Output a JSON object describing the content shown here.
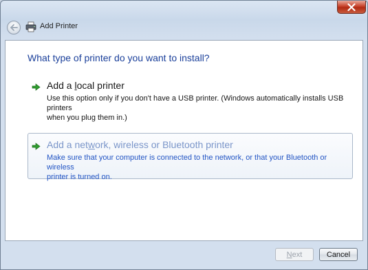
{
  "window": {
    "title": "Add Printer",
    "icons": [
      "back-arrow-icon",
      "printer-icon",
      "close-icon"
    ]
  },
  "content": {
    "question": "What type of printer do you want to install?",
    "options": [
      {
        "title_pre": "Add a ",
        "title_access": "l",
        "title_post": "ocal printer",
        "desc_line1": "Use this option only if you don't have a USB printer. (Windows automatically installs USB printers",
        "desc_line2": "when you plug them in.)",
        "state": "normal"
      },
      {
        "title_pre": "Add a net",
        "title_access": "w",
        "title_post": "ork, wireless or Bluetooth printer",
        "desc_line1": "Make sure that your computer is connected to the network, or that your Bluetooth or wireless",
        "desc_line2": "printer is turned on.",
        "state": "selected"
      }
    ]
  },
  "footer": {
    "next_access": "N",
    "next_rest": "ext",
    "next_enabled": false,
    "cancel_label": "Cancel"
  },
  "colors": {
    "heading": "#1a3f9a",
    "selected_desc": "#2254c4",
    "arrow_green": "#2f9e2f"
  }
}
